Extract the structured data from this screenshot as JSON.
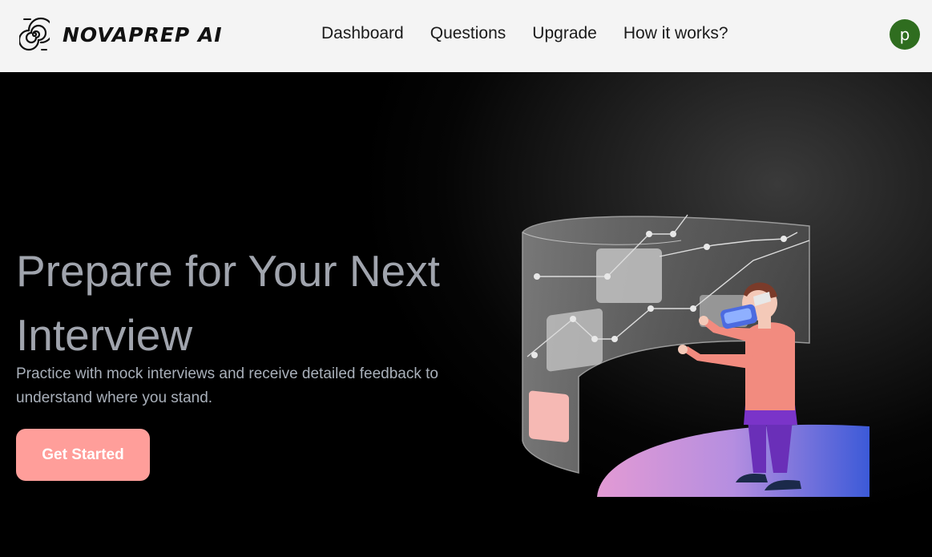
{
  "nav": {
    "brand": "NOVAPREP AI",
    "links": [
      "Dashboard",
      "Questions",
      "Upgrade",
      "How it works?"
    ],
    "avatar_letter": "p"
  },
  "hero": {
    "headline_line1": "Prepare for Your Next",
    "headline_line2": "Interview",
    "subtext_line1": "Practice with mock interviews and receive detailed feedback to",
    "subtext_line2": "understand where you stand.",
    "cta_label": "Get Started"
  },
  "colors": {
    "navbar_bg": "#f4f4f4",
    "avatar_bg": "#2f6d1f",
    "cta_bg": "#ff9e9a",
    "headline": "#a0a4ad",
    "hero_bg": "#000000"
  },
  "icons": [
    "spiral-logo-icon",
    "vr-person-illustration"
  ]
}
